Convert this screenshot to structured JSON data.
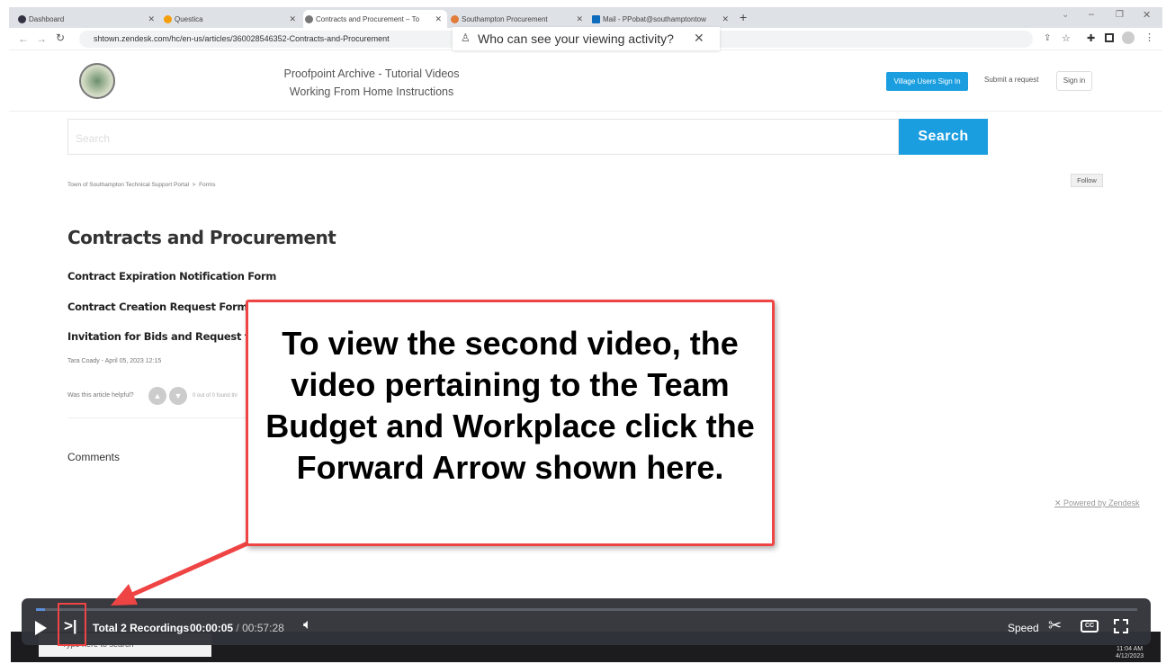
{
  "browser": {
    "tabs": [
      {
        "label": "Dashboard",
        "color": "#334"
      },
      {
        "label": "Questica",
        "color": "#f59e0b"
      },
      {
        "label": "Contracts and Procurement – To",
        "color": "#777",
        "active": true
      },
      {
        "label": "Southampton Procurement",
        "color": "#e07b39"
      },
      {
        "label": "Mail - PPobat@southamptontow",
        "color": "#0f6cbd"
      }
    ],
    "url": "shtown.zendesk.com/hc/en-us/articles/360028546352-Contracts-and-Procurement",
    "popup": "Who can see your viewing activity?"
  },
  "header": {
    "links": [
      "Proofpoint Archive - Tutorial Videos",
      "Working From Home Instructions"
    ],
    "village_signin": "Village Users Sign In",
    "submit_request": "Submit a request",
    "sign_in": "Sign in"
  },
  "search": {
    "placeholder": "Search",
    "button": "Search"
  },
  "breadcrumb": [
    "Town of Southampton Technical Support Portal",
    ">",
    "Forms"
  ],
  "follow": "Follow",
  "article": {
    "title": "Contracts and Procurement",
    "items": [
      "Contract Expiration Notification Form",
      "Contract Creation Request Form",
      "Invitation for Bids and Request for"
    ],
    "meta": "Tara Coady - April 05, 2023 12:15",
    "helpful": "Was this article helpful?",
    "found": "0 out of 0 found thi"
  },
  "comments": "Comments",
  "powered": "Powered by Zendesk",
  "callout": "To view the second video, the video pertaining to the Team Budget and Workplace click the Forward Arrow shown here.",
  "player": {
    "recordings": "Total 2 Recordings",
    "current": "00:00:05",
    "separator": "/",
    "duration": "00:57:28",
    "speed": "Speed",
    "progress": 0.0015,
    "accent": "#ef4444"
  },
  "taskbar": {
    "search": "Type here to search",
    "time": "11:04 AM",
    "date": "4/12/2023"
  }
}
